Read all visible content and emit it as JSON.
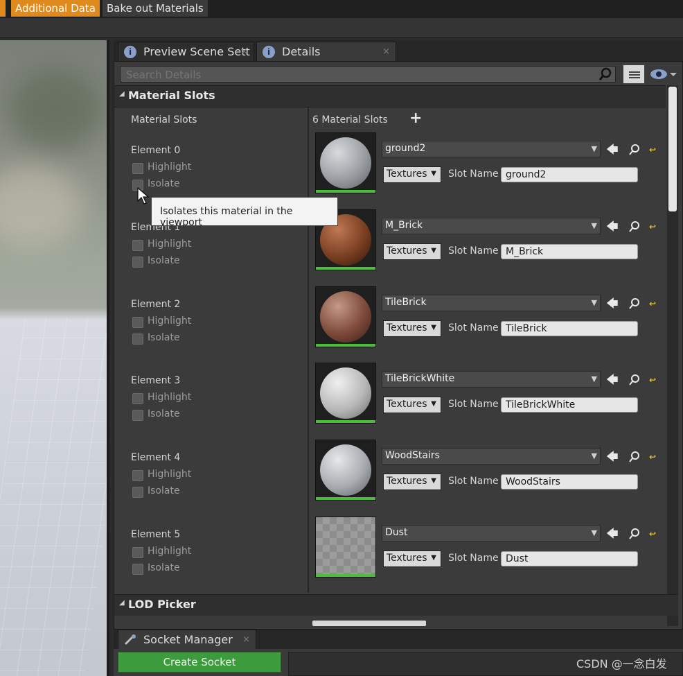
{
  "toolbar": {
    "additional_label": "Additional Data",
    "bake_label": "Bake out Materials"
  },
  "tabs": [
    {
      "label": "Preview Scene Sett",
      "close": "×"
    },
    {
      "label": "Details",
      "close": "×"
    }
  ],
  "search": {
    "placeholder": "Search Details"
  },
  "section": {
    "title": "Material Slots",
    "left_header": "Material Slots",
    "right_header": "6 Material Slots",
    "add_symbol": "+"
  },
  "elements": [
    {
      "label": "Element 0",
      "highlight": "Highlight",
      "isolate": "Isolate",
      "material": "ground2",
      "textures": "Textures",
      "slot_label": "Slot Name",
      "slot_name": "ground2"
    },
    {
      "label": "Element 1",
      "highlight": "Highlight",
      "isolate": "Isolate",
      "material": "M_Brick",
      "textures": "Textures",
      "slot_label": "Slot Name",
      "slot_name": "M_Brick"
    },
    {
      "label": "Element 2",
      "highlight": "Highlight",
      "isolate": "Isolate",
      "material": "TileBrick",
      "textures": "Textures",
      "slot_label": "Slot Name",
      "slot_name": "TileBrick"
    },
    {
      "label": "Element 3",
      "highlight": "Highlight",
      "isolate": "Isolate",
      "material": "TileBrickWhite",
      "textures": "Textures",
      "slot_label": "Slot Name",
      "slot_name": "TileBrickWhite"
    },
    {
      "label": "Element 4",
      "highlight": "Highlight",
      "isolate": "Isolate",
      "material": "WoodStairs",
      "textures": "Textures",
      "slot_label": "Slot Name",
      "slot_name": "WoodStairs"
    },
    {
      "label": "Element 5",
      "highlight": "Highlight",
      "isolate": "Isolate",
      "material": "Dust",
      "textures": "Textures",
      "slot_label": "Slot Name",
      "slot_name": "Dust"
    }
  ],
  "lod": {
    "title": "LOD Picker"
  },
  "tooltip": {
    "text": "Isolates this material in the viewport"
  },
  "socket": {
    "tab_label": "Socket Manager",
    "close": "×",
    "create_label": "Create Socket"
  },
  "watermark": "CSDN @一念白发",
  "colors": {
    "accent": "#e0891d",
    "create_green": "#3c9b3c",
    "thumb_bar": "#4cbd3a",
    "reset_yellow": "#e8c020"
  },
  "icons": {
    "tab_info": "info-icon",
    "search": "search-icon",
    "view_options": "list-icon",
    "visibility": "eye-icon",
    "browse": "arrow-left-icon",
    "find": "magnifier-icon",
    "reset": "reset-arrow-icon",
    "socket_tab": "socket-icon"
  }
}
